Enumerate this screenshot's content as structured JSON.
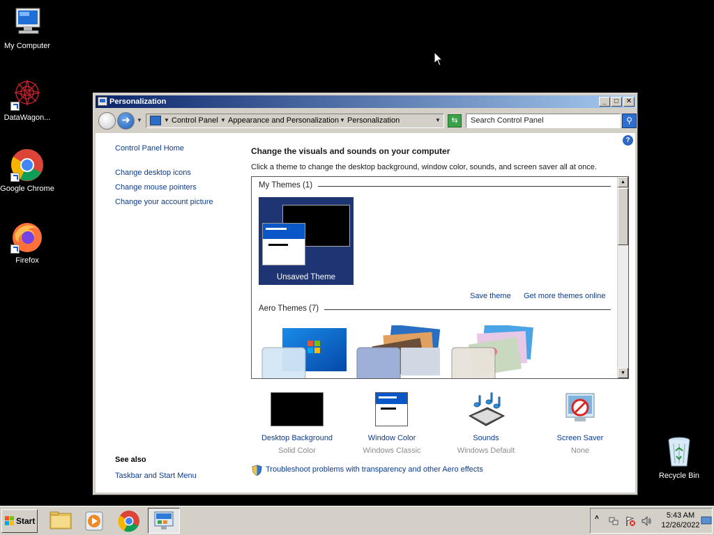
{
  "desktop": {
    "icons": [
      {
        "label": "My Computer"
      },
      {
        "label": "DataWagon..."
      },
      {
        "label": "Google Chrome"
      },
      {
        "label": "Firefox"
      },
      {
        "label": "Recycle Bin"
      }
    ]
  },
  "window": {
    "title": "Personalization",
    "buttons": {
      "minimize": "_",
      "maximize": "□",
      "close": "✕"
    },
    "breadcrumb": [
      "Control Panel",
      "Appearance and Personalization",
      "Personalization"
    ],
    "search_placeholder": "Search Control Panel",
    "left_nav": {
      "home": "Control Panel Home",
      "links": [
        "Change desktop icons",
        "Change mouse pointers",
        "Change your account picture"
      ],
      "see_also_title": "See also",
      "see_also_links": [
        "Taskbar and Start Menu"
      ]
    },
    "main": {
      "heading": "Change the visuals and sounds on your computer",
      "instruction": "Click a theme to change the desktop background, window color, sounds, and screen saver all at once.",
      "my_themes_header": "My Themes (1)",
      "my_themes": [
        {
          "name": "Unsaved Theme"
        }
      ],
      "save_theme": "Save theme",
      "get_more_themes": "Get more themes online",
      "aero_themes_header": "Aero Themes (7)",
      "settings": [
        {
          "name": "Desktop Background",
          "value": "Solid Color"
        },
        {
          "name": "Window Color",
          "value": "Windows Classic"
        },
        {
          "name": "Sounds",
          "value": "Windows Default"
        },
        {
          "name": "Screen Saver",
          "value": "None"
        }
      ],
      "troubleshoot_link": "Troubleshoot problems with transparency and other Aero effects"
    }
  },
  "taskbar": {
    "start_label": "Start",
    "clock": {
      "time": "5:43 AM",
      "date": "12/26/2022"
    }
  },
  "colors": {
    "desktop": "#000000",
    "link": "#0b3a8c",
    "titlebar_start": "#0a246a",
    "titlebar_end": "#a6caf0",
    "theme_tile": "#1e3473"
  }
}
